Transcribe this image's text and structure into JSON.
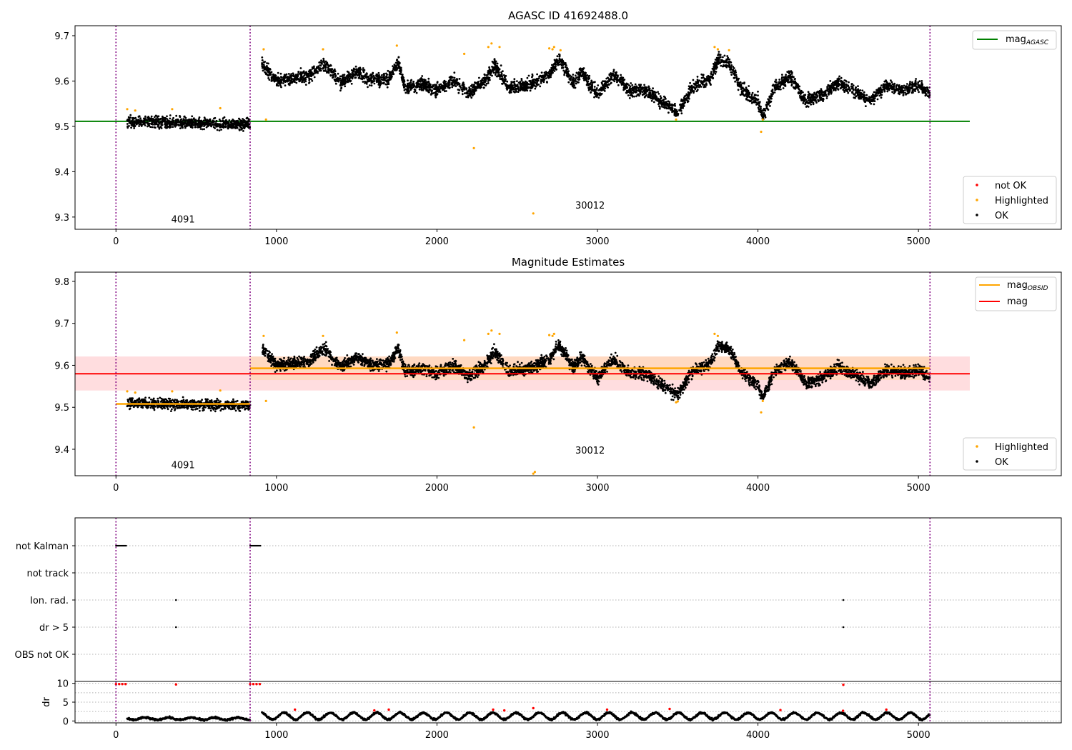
{
  "figure": {
    "panels": [
      "agasc-panel",
      "estimates-panel",
      "flags-panel",
      "dr-panel"
    ]
  },
  "chart_data": [
    {
      "id": "agasc-panel",
      "type": "scatter",
      "title": "AGASC ID 41692488.0",
      "xlabel": "",
      "ylabel": "",
      "xlim": [
        -255,
        5890
      ],
      "ylim": [
        9.273,
        9.722
      ],
      "xticks": [
        0,
        1000,
        2000,
        3000,
        4000,
        5000
      ],
      "yticks": [
        9.3,
        9.4,
        9.5,
        9.6,
        9.7
      ],
      "grid": false,
      "observation_boundaries": [
        0,
        836,
        5072
      ],
      "observation_labels": [
        {
          "text": "4091",
          "x": 418,
          "y": 9.288
        },
        {
          "text": "30012",
          "x": 2954,
          "y": 9.319
        }
      ],
      "reference_lines": [
        {
          "name": "mag_AGASC",
          "y": 9.511,
          "x": [
            -255,
            5320
          ],
          "color": "#008000"
        }
      ],
      "legends": [
        {
          "placement": "top-right",
          "entries": [
            {
              "label_main": "mag",
              "label_sub": "AGASC",
              "kind": "line",
              "color": "#008000"
            }
          ]
        },
        {
          "placement": "lower-right",
          "entries": [
            {
              "label": "not OK",
              "kind": "marker",
              "color": "#ff0000"
            },
            {
              "label": "Highlighted",
              "kind": "marker",
              "color": "#ffa500"
            },
            {
              "label": "OK",
              "kind": "marker",
              "color": "#000000"
            }
          ]
        }
      ],
      "highlighted": [
        [
          70,
          9.538
        ],
        [
          120,
          9.535
        ],
        [
          350,
          9.538
        ],
        [
          650,
          9.54
        ],
        [
          920,
          9.67
        ],
        [
          935,
          9.515
        ],
        [
          1290,
          9.67
        ],
        [
          1750,
          9.678
        ],
        [
          2170,
          9.66
        ],
        [
          2230,
          9.452
        ],
        [
          2320,
          9.675
        ],
        [
          2340,
          9.683
        ],
        [
          2390,
          9.675
        ],
        [
          2600,
          9.308
        ],
        [
          2700,
          9.672
        ],
        [
          2720,
          9.67
        ],
        [
          2730,
          9.675
        ],
        [
          2770,
          9.668
        ],
        [
          3490,
          9.515
        ],
        [
          3730,
          9.675
        ],
        [
          3750,
          9.67
        ],
        [
          3820,
          9.668
        ],
        [
          4020,
          9.488
        ],
        [
          4030,
          9.515
        ]
      ],
      "ok_series": {
        "note": "segments of piecewise-linear mean magnitude with scatter",
        "segments": [
          {
            "x": [
              70,
              836
            ],
            "y": [
              9.51,
              9.505
            ],
            "spread": 0.012
          },
          {
            "x": [
              910,
              1000,
              1100,
              1200,
              1300,
              1400,
              1500,
              1600,
              1700,
              1760,
              1800,
              1900,
              2000,
              2100,
              2200,
              2300,
              2360,
              2450,
              2600,
              2700,
              2760,
              2850,
              2900,
              3000,
              3100,
              3200,
              3300,
              3400,
              3500,
              3600,
              3700,
              3750,
              3820,
              3900,
              4000,
              4030,
              4100,
              4200,
              4300,
              4400,
              4500,
              4600,
              4700,
              4800,
              4900,
              5000,
              5072
            ],
            "y": [
              9.64,
              9.6,
              9.605,
              9.61,
              9.64,
              9.595,
              9.62,
              9.6,
              9.605,
              9.64,
              9.585,
              9.595,
              9.58,
              9.6,
              9.575,
              9.6,
              9.635,
              9.585,
              9.595,
              9.615,
              9.65,
              9.595,
              9.62,
              9.57,
              9.615,
              9.58,
              9.58,
              9.555,
              9.53,
              9.59,
              9.605,
              9.645,
              9.64,
              9.58,
              9.555,
              9.52,
              9.585,
              9.61,
              9.555,
              9.57,
              9.595,
              9.58,
              9.555,
              9.59,
              9.58,
              9.59,
              9.57
            ],
            "spread": 0.014
          }
        ]
      }
    },
    {
      "id": "estimates-panel",
      "type": "scatter",
      "title": "Magnitude Estimates",
      "xlabel": "",
      "ylabel": "",
      "xlim": [
        -255,
        5890
      ],
      "ylim": [
        9.337,
        9.822
      ],
      "xticks": [
        0,
        1000,
        2000,
        3000,
        4000,
        5000
      ],
      "yticks": [
        9.4,
        9.5,
        9.6,
        9.7,
        9.8
      ],
      "grid": false,
      "observation_boundaries": [
        0,
        836,
        5072
      ],
      "observation_labels": [
        {
          "text": "4091",
          "x": 418,
          "y": 9.355
        },
        {
          "text": "30012",
          "x": 2954,
          "y": 9.39
        }
      ],
      "reference_lines": [
        {
          "name": "mag",
          "y": 9.58,
          "x": [
            -255,
            5320
          ],
          "color": "#ff0000",
          "band": [
            9.54,
            9.621
          ],
          "band_color": "#ffb3b8"
        },
        {
          "name": "mag_OBSID 4091",
          "y": 9.508,
          "x": [
            0,
            836
          ],
          "color": "#ffa500"
        },
        {
          "name": "mag_OBSID 30012",
          "y": 9.593,
          "x": [
            836,
            5072
          ],
          "color": "#ffa500",
          "band": [
            9.565,
            9.621
          ],
          "band_color": "#ffd5a8"
        }
      ],
      "legends": [
        {
          "placement": "top-right",
          "entries": [
            {
              "label_main": "mag",
              "label_sub": "OBSID",
              "kind": "line",
              "color": "#ffa500"
            },
            {
              "label": "mag",
              "kind": "line",
              "color": "#ff0000"
            }
          ]
        },
        {
          "placement": "lower-right",
          "entries": [
            {
              "label": "Highlighted",
              "kind": "marker",
              "color": "#ffa500"
            },
            {
              "label": "OK",
              "kind": "marker",
              "color": "#000000"
            }
          ]
        }
      ],
      "highlighted": [
        [
          70,
          9.538
        ],
        [
          120,
          9.535
        ],
        [
          350,
          9.538
        ],
        [
          650,
          9.54
        ],
        [
          920,
          9.67
        ],
        [
          935,
          9.515
        ],
        [
          1290,
          9.67
        ],
        [
          1750,
          9.678
        ],
        [
          2170,
          9.66
        ],
        [
          2230,
          9.452
        ],
        [
          2320,
          9.675
        ],
        [
          2340,
          9.683
        ],
        [
          2390,
          9.675
        ],
        [
          2600,
          9.342
        ],
        [
          2610,
          9.346
        ],
        [
          2700,
          9.672
        ],
        [
          2720,
          9.67
        ],
        [
          2730,
          9.675
        ],
        [
          3490,
          9.512
        ],
        [
          3500,
          9.514
        ],
        [
          3730,
          9.675
        ],
        [
          3750,
          9.67
        ],
        [
          4020,
          9.488
        ],
        [
          4030,
          9.515
        ]
      ]
    },
    {
      "id": "flags-panel",
      "type": "scatter",
      "title": "",
      "categories": [
        "not Kalman",
        "not track",
        "Ion. rad.",
        "dr > 5",
        "OBS not OK"
      ],
      "observation_boundaries": [
        0,
        836,
        5072
      ],
      "grid": true,
      "flag_points": [
        {
          "category": "not Kalman",
          "x_ranges": [
            [
              0,
              65
            ],
            [
              836,
              900
            ]
          ]
        },
        {
          "category": "Ion. rad.",
          "x": [
            374,
            4532
          ]
        },
        {
          "category": "dr > 5",
          "x": [
            374,
            4532
          ]
        }
      ]
    },
    {
      "id": "dr-panel",
      "type": "scatter",
      "title": "",
      "ylabel": "dr",
      "xlim": [
        -255,
        5890
      ],
      "ylim": [
        -0.5,
        10.5
      ],
      "yticks": [
        0,
        5,
        10
      ],
      "xticks": [
        0,
        1000,
        2000,
        3000,
        4000,
        5000
      ],
      "grid": true,
      "observation_boundaries": [
        0,
        836,
        5072
      ],
      "red_points": [
        [
          0,
          9.8
        ],
        [
          20,
          9.8
        ],
        [
          40,
          9.8
        ],
        [
          60,
          9.8
        ],
        [
          374,
          9.7
        ],
        [
          836,
          9.8
        ],
        [
          856,
          9.8
        ],
        [
          876,
          9.8
        ],
        [
          896,
          9.8
        ],
        [
          4532,
          9.6
        ],
        [
          1115,
          3.0
        ],
        [
          1610,
          2.8
        ],
        [
          1700,
          3.0
        ],
        [
          2350,
          3.0
        ],
        [
          2420,
          2.8
        ],
        [
          2600,
          3.4
        ],
        [
          3060,
          3.0
        ],
        [
          3450,
          3.2
        ],
        [
          4140,
          2.9
        ],
        [
          4530,
          2.7
        ],
        [
          4800,
          3.0
        ]
      ],
      "ok_series": {
        "x_ranges": [
          [
            70,
            836
          ],
          [
            910,
            5072
          ]
        ],
        "mean": 0.6,
        "mean_obs2": 1.3,
        "spread": 0.7
      }
    }
  ]
}
